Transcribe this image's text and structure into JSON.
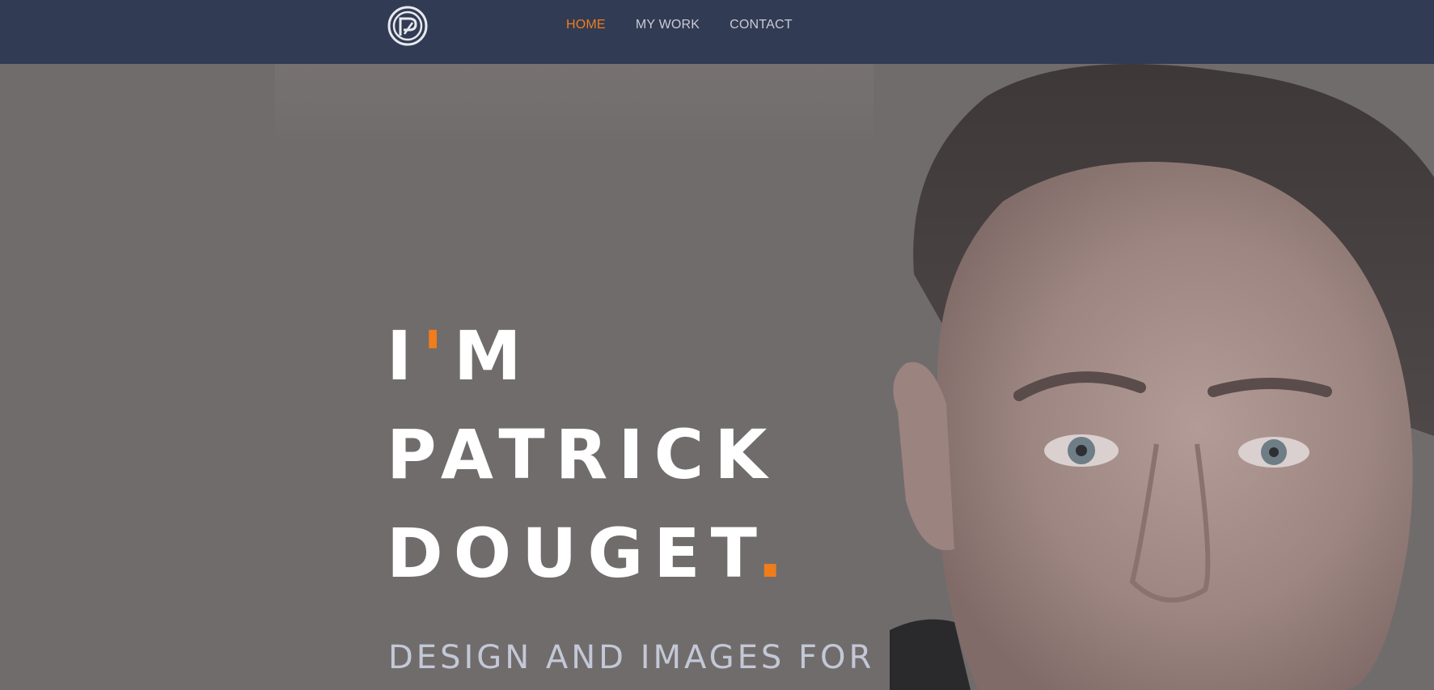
{
  "header": {
    "logo_name": "pd-monogram-logo",
    "nav": [
      {
        "label": "HOME",
        "active": true
      },
      {
        "label": "MY WORK",
        "active": false
      },
      {
        "label": "CONTACT",
        "active": false
      }
    ]
  },
  "hero": {
    "headline": {
      "line1_a": "I",
      "line1_apostrophe": "'",
      "line1_b": "M",
      "line2": "PATRICK",
      "line3": "DOUGET",
      "line3_dot": "."
    },
    "tagline": "DESIGN AND IMAGES FOR",
    "portrait_icon": "portrait-photo"
  },
  "colors": {
    "header_bg": "#323b54",
    "accent": "#f07d1a",
    "hero_bg": "#716c6c",
    "nav_text": "#c9ccd6",
    "tagline_text": "#c3c8d6"
  }
}
